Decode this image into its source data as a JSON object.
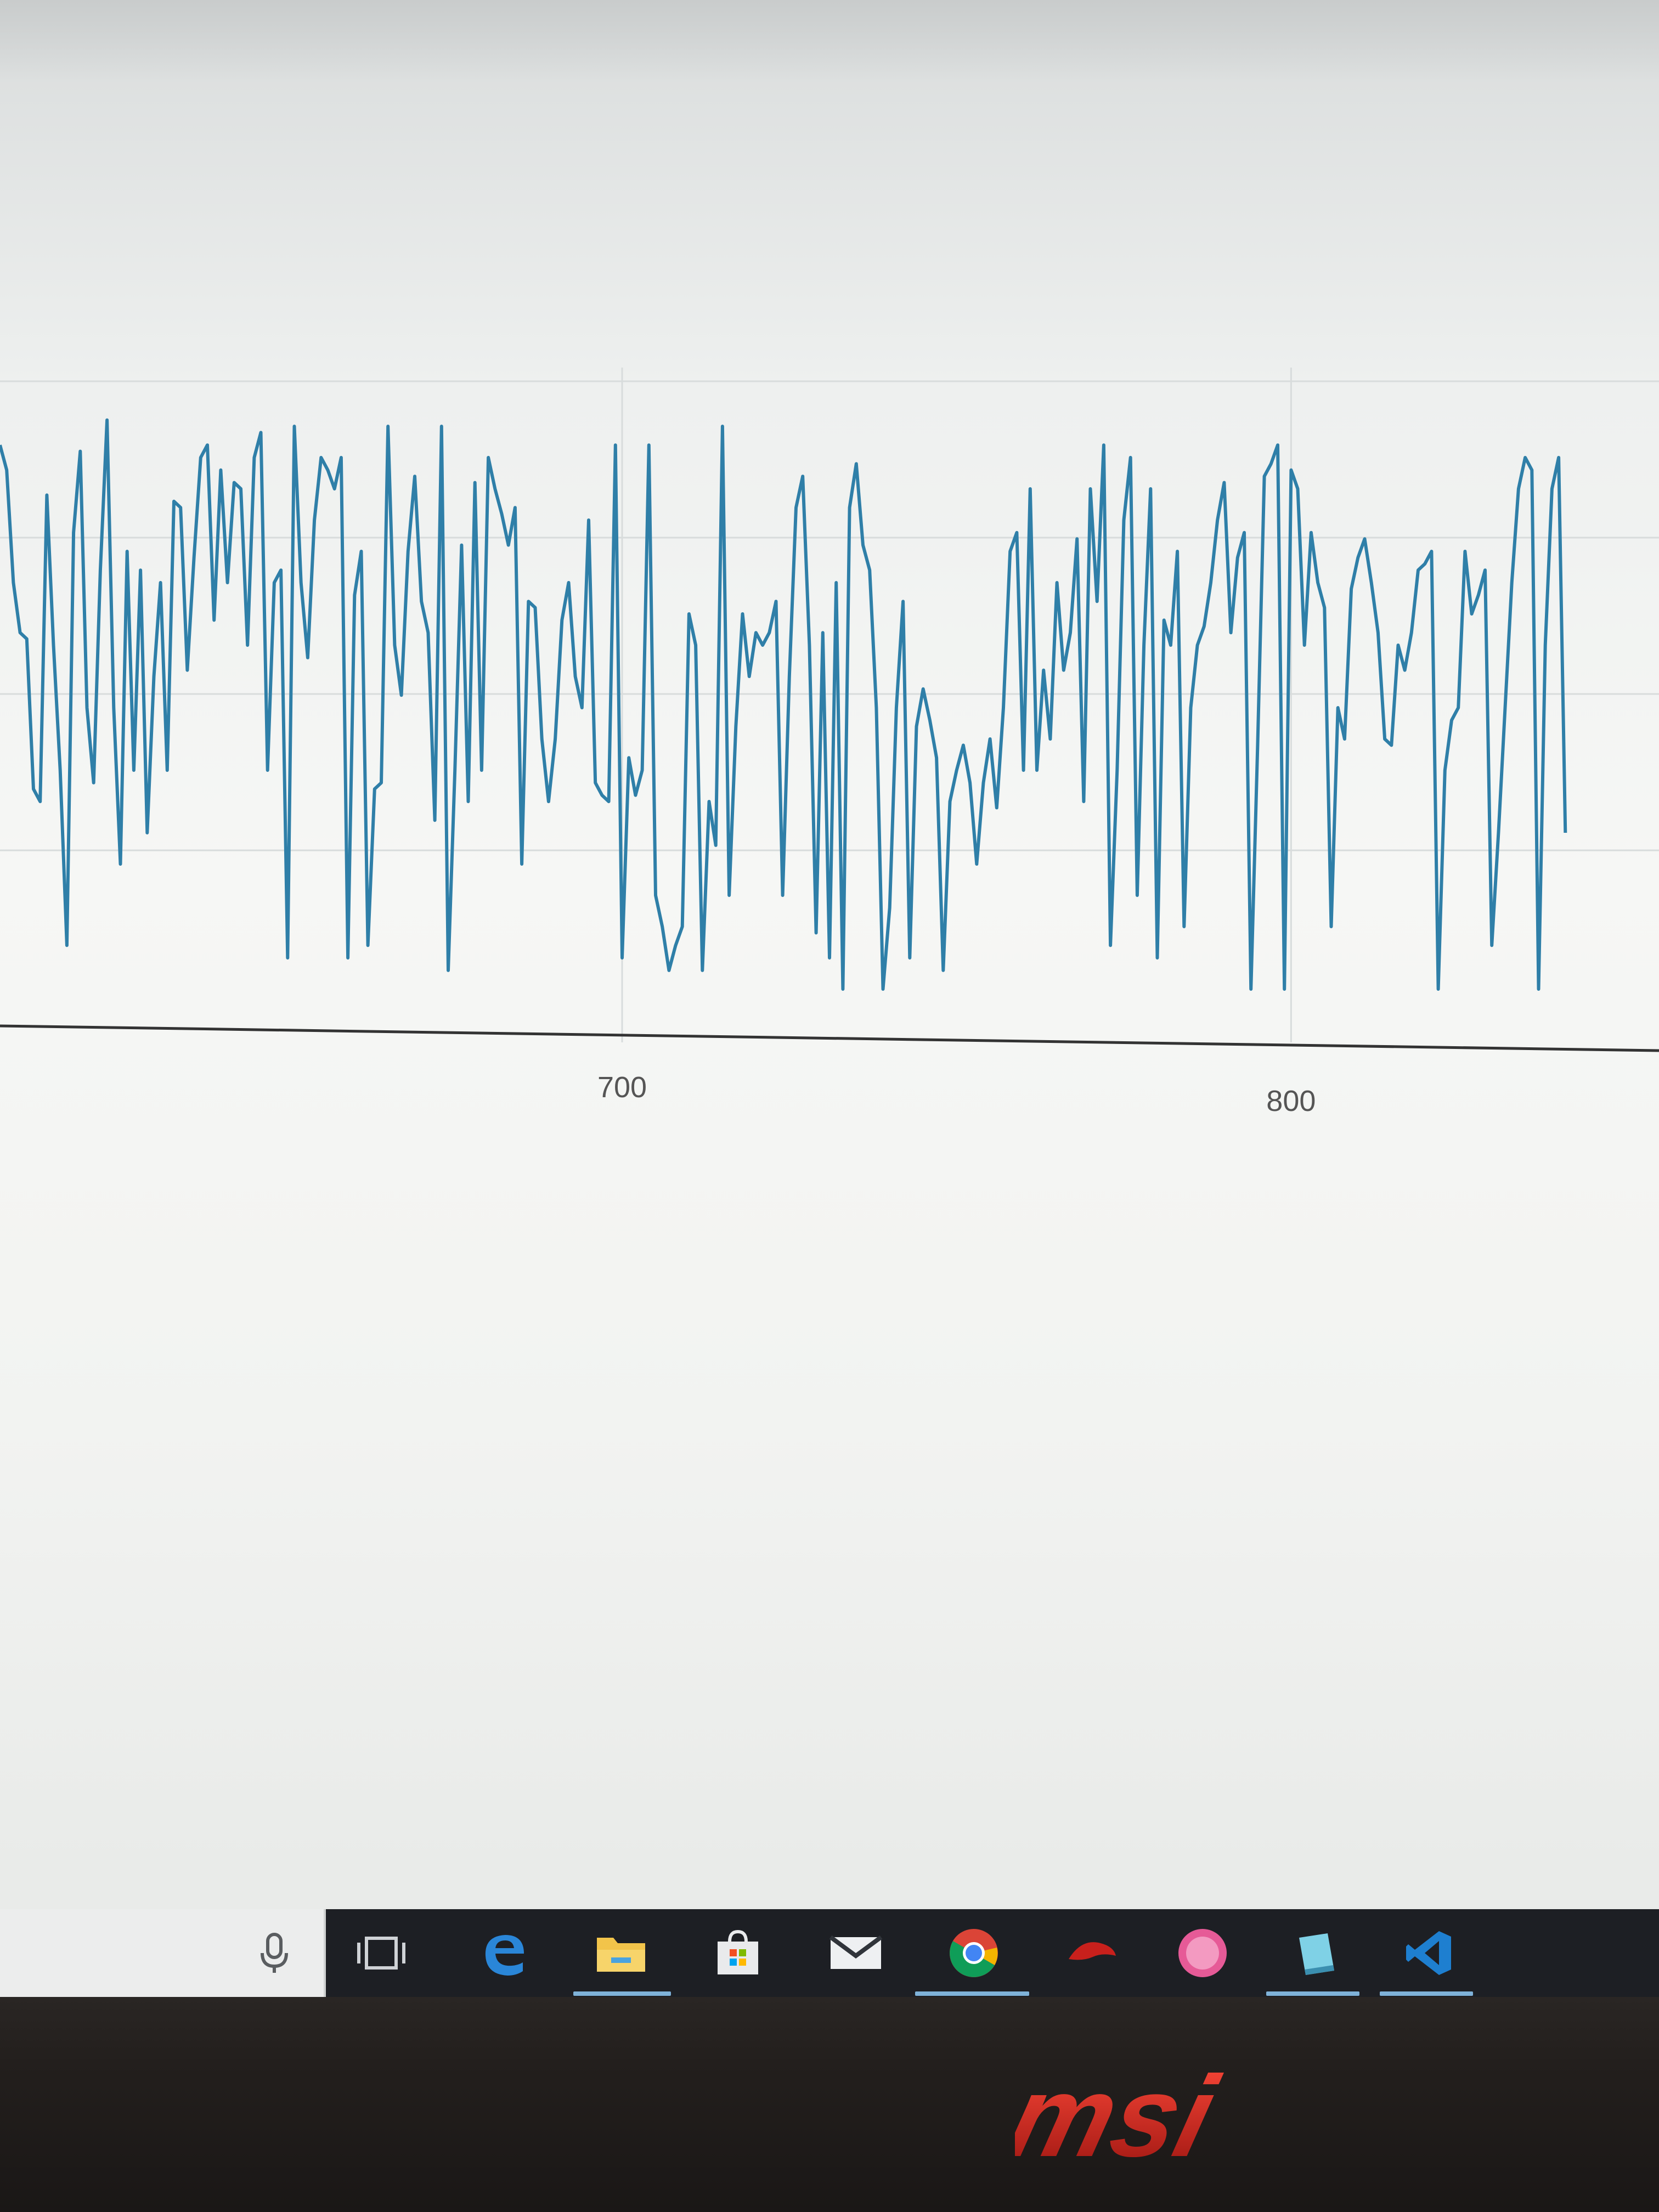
{
  "chart_data": {
    "type": "line",
    "title": "",
    "xlabel": "",
    "ylabel": "",
    "x_ticks": [
      "700",
      "800"
    ],
    "x_tick_values": [
      700,
      800
    ],
    "xlim": [
      607,
      855
    ],
    "ylim": [
      0,
      100
    ],
    "grid": true,
    "colors": {
      "line": "#2f7fa8",
      "axis": "#333333",
      "grid": "#d8dcdc"
    },
    "series": [
      {
        "name": "",
        "values": [
          [
            607,
            92
          ],
          [
            608,
            88
          ],
          [
            609,
            70
          ],
          [
            610,
            62
          ],
          [
            611,
            61
          ],
          [
            612,
            37
          ],
          [
            613,
            35
          ],
          [
            614,
            84
          ],
          [
            615,
            60
          ],
          [
            616,
            40
          ],
          [
            617,
            12
          ],
          [
            618,
            78
          ],
          [
            619,
            91
          ],
          [
            620,
            50
          ],
          [
            621,
            38
          ],
          [
            622,
            72
          ],
          [
            623,
            96
          ],
          [
            624,
            50
          ],
          [
            625,
            25
          ],
          [
            626,
            75
          ],
          [
            627,
            40
          ],
          [
            628,
            72
          ],
          [
            629,
            30
          ],
          [
            630,
            55
          ],
          [
            631,
            70
          ],
          [
            632,
            40
          ],
          [
            633,
            83
          ],
          [
            634,
            82
          ],
          [
            635,
            56
          ],
          [
            636,
            74
          ],
          [
            637,
            90
          ],
          [
            638,
            92
          ],
          [
            639,
            64
          ],
          [
            640,
            88
          ],
          [
            641,
            70
          ],
          [
            642,
            86
          ],
          [
            643,
            85
          ],
          [
            644,
            60
          ],
          [
            645,
            90
          ],
          [
            646,
            94
          ],
          [
            647,
            40
          ],
          [
            648,
            70
          ],
          [
            649,
            72
          ],
          [
            650,
            10
          ],
          [
            651,
            95
          ],
          [
            652,
            70
          ],
          [
            653,
            58
          ],
          [
            654,
            80
          ],
          [
            655,
            90
          ],
          [
            656,
            88
          ],
          [
            657,
            85
          ],
          [
            658,
            90
          ],
          [
            659,
            10
          ],
          [
            660,
            68
          ],
          [
            661,
            75
          ],
          [
            662,
            12
          ],
          [
            663,
            37
          ],
          [
            664,
            38
          ],
          [
            665,
            95
          ],
          [
            666,
            60
          ],
          [
            667,
            52
          ],
          [
            668,
            75
          ],
          [
            669,
            87
          ],
          [
            670,
            67
          ],
          [
            671,
            62
          ],
          [
            672,
            32
          ],
          [
            673,
            95
          ],
          [
            674,
            8
          ],
          [
            675,
            40
          ],
          [
            676,
            76
          ],
          [
            677,
            35
          ],
          [
            678,
            86
          ],
          [
            679,
            40
          ],
          [
            680,
            90
          ],
          [
            681,
            85
          ],
          [
            682,
            81
          ],
          [
            683,
            76
          ],
          [
            684,
            82
          ],
          [
            685,
            25
          ],
          [
            686,
            67
          ],
          [
            687,
            66
          ],
          [
            688,
            45
          ],
          [
            689,
            35
          ],
          [
            690,
            45
          ],
          [
            691,
            64
          ],
          [
            692,
            70
          ],
          [
            693,
            55
          ],
          [
            694,
            50
          ],
          [
            695,
            80
          ],
          [
            696,
            38
          ],
          [
            697,
            36
          ],
          [
            698,
            35
          ],
          [
            699,
            92
          ],
          [
            700,
            10
          ],
          [
            701,
            42
          ],
          [
            702,
            36
          ],
          [
            703,
            40
          ],
          [
            704,
            92
          ],
          [
            705,
            20
          ],
          [
            706,
            15
          ],
          [
            707,
            8
          ],
          [
            708,
            12
          ],
          [
            709,
            15
          ],
          [
            710,
            65
          ],
          [
            711,
            60
          ],
          [
            712,
            8
          ],
          [
            713,
            35
          ],
          [
            714,
            28
          ],
          [
            715,
            95
          ],
          [
            716,
            20
          ],
          [
            717,
            47
          ],
          [
            718,
            65
          ],
          [
            719,
            55
          ],
          [
            720,
            62
          ],
          [
            721,
            60
          ],
          [
            722,
            62
          ],
          [
            723,
            67
          ],
          [
            724,
            20
          ],
          [
            725,
            55
          ],
          [
            726,
            82
          ],
          [
            727,
            87
          ],
          [
            728,
            60
          ],
          [
            729,
            14
          ],
          [
            730,
            62
          ],
          [
            731,
            10
          ],
          [
            732,
            70
          ],
          [
            733,
            5
          ],
          [
            734,
            82
          ],
          [
            735,
            89
          ],
          [
            736,
            76
          ],
          [
            737,
            72
          ],
          [
            738,
            50
          ],
          [
            739,
            5
          ],
          [
            740,
            18
          ],
          [
            741,
            50
          ],
          [
            742,
            67
          ],
          [
            743,
            10
          ],
          [
            744,
            47
          ],
          [
            745,
            53
          ],
          [
            746,
            48
          ],
          [
            747,
            42
          ],
          [
            748,
            8
          ],
          [
            749,
            35
          ],
          [
            750,
            40
          ],
          [
            751,
            44
          ],
          [
            752,
            38
          ],
          [
            753,
            25
          ],
          [
            754,
            38
          ],
          [
            755,
            45
          ],
          [
            756,
            34
          ],
          [
            757,
            50
          ],
          [
            758,
            75
          ],
          [
            759,
            78
          ],
          [
            760,
            40
          ],
          [
            761,
            85
          ],
          [
            762,
            40
          ],
          [
            763,
            56
          ],
          [
            764,
            45
          ],
          [
            765,
            70
          ],
          [
            766,
            56
          ],
          [
            767,
            62
          ],
          [
            768,
            77
          ],
          [
            769,
            35
          ],
          [
            770,
            85
          ],
          [
            771,
            67
          ],
          [
            772,
            92
          ],
          [
            773,
            12
          ],
          [
            774,
            40
          ],
          [
            775,
            80
          ],
          [
            776,
            90
          ],
          [
            777,
            20
          ],
          [
            778,
            60
          ],
          [
            779,
            85
          ],
          [
            780,
            10
          ],
          [
            781,
            64
          ],
          [
            782,
            60
          ],
          [
            783,
            75
          ],
          [
            784,
            15
          ],
          [
            785,
            50
          ],
          [
            786,
            60
          ],
          [
            787,
            63
          ],
          [
            788,
            70
          ],
          [
            789,
            80
          ],
          [
            790,
            86
          ],
          [
            791,
            62
          ],
          [
            792,
            74
          ],
          [
            793,
            78
          ],
          [
            794,
            5
          ],
          [
            795,
            44
          ],
          [
            796,
            87
          ],
          [
            797,
            89
          ],
          [
            798,
            92
          ],
          [
            799,
            5
          ],
          [
            800,
            88
          ],
          [
            801,
            85
          ],
          [
            802,
            60
          ],
          [
            803,
            78
          ],
          [
            804,
            70
          ],
          [
            805,
            66
          ],
          [
            806,
            15
          ],
          [
            807,
            50
          ],
          [
            808,
            45
          ],
          [
            809,
            69
          ],
          [
            810,
            74
          ],
          [
            811,
            77
          ],
          [
            812,
            70
          ],
          [
            813,
            62
          ],
          [
            814,
            45
          ],
          [
            815,
            44
          ],
          [
            816,
            60
          ],
          [
            817,
            56
          ],
          [
            818,
            62
          ],
          [
            819,
            72
          ],
          [
            820,
            73
          ],
          [
            821,
            75
          ],
          [
            822,
            5
          ],
          [
            823,
            40
          ],
          [
            824,
            48
          ],
          [
            825,
            50
          ],
          [
            826,
            75
          ],
          [
            827,
            65
          ],
          [
            828,
            68
          ],
          [
            829,
            72
          ],
          [
            830,
            12
          ],
          [
            831,
            30
          ],
          [
            832,
            50
          ],
          [
            833,
            70
          ],
          [
            834,
            85
          ],
          [
            835,
            90
          ],
          [
            836,
            88
          ],
          [
            837,
            5
          ],
          [
            838,
            60
          ],
          [
            839,
            85
          ],
          [
            840,
            90
          ],
          [
            841,
            30
          ]
        ]
      }
    ]
  },
  "taskbar": {
    "icons": [
      "microphone-icon",
      "task-view-icon",
      "edge-icon",
      "file-explorer-icon",
      "store-icon",
      "mail-icon",
      "chrome-icon",
      "red-app-icon",
      "pink-app-icon",
      "notes-app-icon",
      "vscode-icon"
    ]
  },
  "bezel": {
    "brand": "msi"
  }
}
